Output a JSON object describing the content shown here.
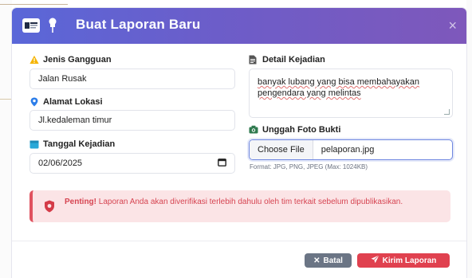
{
  "modal": {
    "title": "Buat Laporan Baru",
    "close_symbol": "×"
  },
  "form": {
    "jenis_gangguan": {
      "label": "Jenis Gangguan",
      "value": "Jalan Rusak",
      "icon": "warning-icon"
    },
    "alamat_lokasi": {
      "label": "Alamat Lokasi",
      "value": "Jl.kedaleman timur",
      "icon": "map-pin-icon"
    },
    "tanggal_kejadian": {
      "label": "Tanggal Kejadian",
      "value": "02/06/2025",
      "icon": "calendar-icon"
    },
    "detail_kejadian": {
      "label": "Detail Kejadian",
      "value_line1": "banyak lubang yang bisa membahayakan",
      "value_line2": "pengendara yang melintas",
      "icon": "document-icon"
    },
    "unggah_foto": {
      "label": "Unggah Foto Bukti",
      "button": "Choose File",
      "file_name": "pelaporan.jpg",
      "hint": "Format: JPG, PNG, JPEG (Max: 1024KB)",
      "icon": "camera-icon"
    }
  },
  "alert": {
    "strong": "Penting!",
    "text": " Laporan Anda akan diverifikasi terlebih dahulu oleh tim terkait sebelum dipublikasikan."
  },
  "footer": {
    "cancel_label": "Batal",
    "submit_label": "Kirim Laporan"
  },
  "colors": {
    "header_start": "#5a67d8",
    "header_end": "#7e58bb",
    "warning": "#f5b400",
    "info": "#2b7de9",
    "calendar": "#29a8d8",
    "camera": "#2f7a4f",
    "danger": "#e0414f",
    "secondary": "#6b7585"
  }
}
